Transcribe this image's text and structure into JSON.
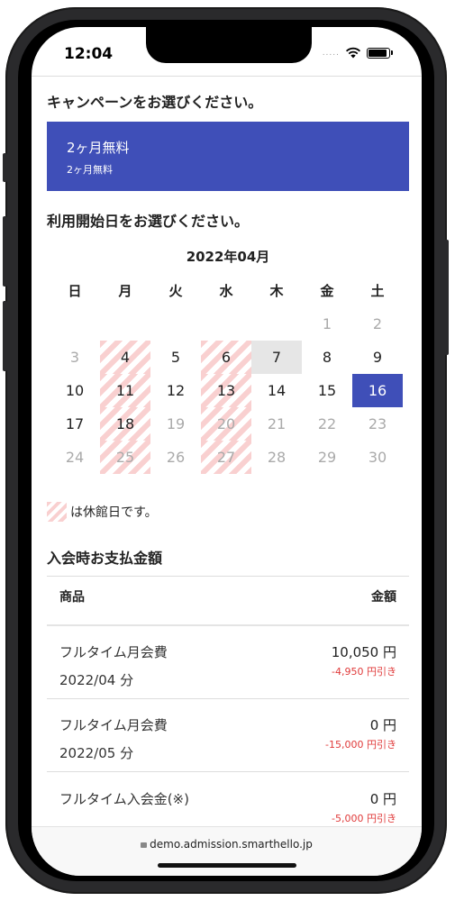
{
  "status": {
    "time": "12:04",
    "dots": "....."
  },
  "campaign_section": {
    "title": "キャンペーンをお選びください。",
    "selected": {
      "main": "2ヶ月無料",
      "sub": "2ヶ月無料"
    }
  },
  "start_section": {
    "title": "利用開始日をお選びください。"
  },
  "calendar": {
    "month": "2022年04月",
    "weekdays": [
      "日",
      "月",
      "火",
      "水",
      "木",
      "金",
      "土"
    ],
    "weeks": [
      [
        "",
        "",
        "",
        "",
        "",
        "1",
        "2"
      ],
      [
        "3",
        "4",
        "5",
        "6",
        "7",
        "8",
        "9"
      ],
      [
        "10",
        "11",
        "12",
        "13",
        "14",
        "15",
        "16"
      ],
      [
        "17",
        "18",
        "19",
        "20",
        "21",
        "22",
        "23"
      ],
      [
        "24",
        "25",
        "26",
        "27",
        "28",
        "29",
        "30"
      ]
    ]
  },
  "legend": {
    "text": "は休館日です。"
  },
  "payment": {
    "title": "入会時お支払金額",
    "col_product": "商品",
    "col_amount": "金額",
    "items": [
      {
        "name": "フルタイム月会費",
        "period": "2022/04 分",
        "price": "10,050 円",
        "discount": "-4,950 円引き"
      },
      {
        "name": "フルタイム月会費",
        "period": "2022/05 分",
        "price": "0 円",
        "discount": "-15,000 円引き"
      },
      {
        "name": "フルタイム入会金(※)",
        "period": "",
        "price": "0 円",
        "discount": "-5,000 円引き"
      }
    ]
  },
  "browser": {
    "url": "demo.admission.smarthello.jp"
  },
  "colors": {
    "accent": "#3f4fb8",
    "discount": "#e03a3a",
    "holiday": "#f9d0d0"
  }
}
